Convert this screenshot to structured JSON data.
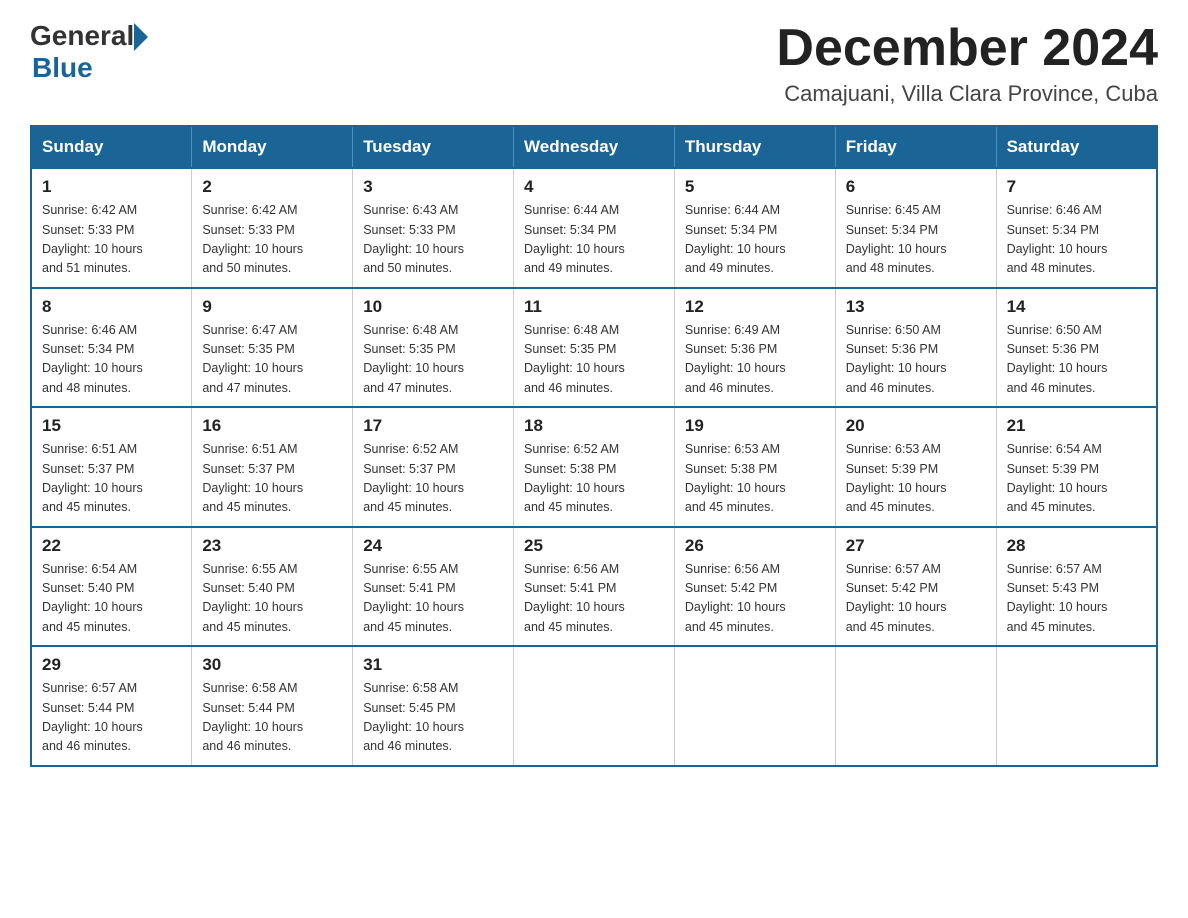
{
  "header": {
    "logo_general": "General",
    "logo_blue": "Blue",
    "month_title": "December 2024",
    "subtitle": "Camajuani, Villa Clara Province, Cuba"
  },
  "days_of_week": [
    "Sunday",
    "Monday",
    "Tuesday",
    "Wednesday",
    "Thursday",
    "Friday",
    "Saturday"
  ],
  "weeks": [
    [
      {
        "day": "1",
        "sunrise": "6:42 AM",
        "sunset": "5:33 PM",
        "daylight": "10 hours and 51 minutes."
      },
      {
        "day": "2",
        "sunrise": "6:42 AM",
        "sunset": "5:33 PM",
        "daylight": "10 hours and 50 minutes."
      },
      {
        "day": "3",
        "sunrise": "6:43 AM",
        "sunset": "5:33 PM",
        "daylight": "10 hours and 50 minutes."
      },
      {
        "day": "4",
        "sunrise": "6:44 AM",
        "sunset": "5:34 PM",
        "daylight": "10 hours and 49 minutes."
      },
      {
        "day": "5",
        "sunrise": "6:44 AM",
        "sunset": "5:34 PM",
        "daylight": "10 hours and 49 minutes."
      },
      {
        "day": "6",
        "sunrise": "6:45 AM",
        "sunset": "5:34 PM",
        "daylight": "10 hours and 48 minutes."
      },
      {
        "day": "7",
        "sunrise": "6:46 AM",
        "sunset": "5:34 PM",
        "daylight": "10 hours and 48 minutes."
      }
    ],
    [
      {
        "day": "8",
        "sunrise": "6:46 AM",
        "sunset": "5:34 PM",
        "daylight": "10 hours and 48 minutes."
      },
      {
        "day": "9",
        "sunrise": "6:47 AM",
        "sunset": "5:35 PM",
        "daylight": "10 hours and 47 minutes."
      },
      {
        "day": "10",
        "sunrise": "6:48 AM",
        "sunset": "5:35 PM",
        "daylight": "10 hours and 47 minutes."
      },
      {
        "day": "11",
        "sunrise": "6:48 AM",
        "sunset": "5:35 PM",
        "daylight": "10 hours and 46 minutes."
      },
      {
        "day": "12",
        "sunrise": "6:49 AM",
        "sunset": "5:36 PM",
        "daylight": "10 hours and 46 minutes."
      },
      {
        "day": "13",
        "sunrise": "6:50 AM",
        "sunset": "5:36 PM",
        "daylight": "10 hours and 46 minutes."
      },
      {
        "day": "14",
        "sunrise": "6:50 AM",
        "sunset": "5:36 PM",
        "daylight": "10 hours and 46 minutes."
      }
    ],
    [
      {
        "day": "15",
        "sunrise": "6:51 AM",
        "sunset": "5:37 PM",
        "daylight": "10 hours and 45 minutes."
      },
      {
        "day": "16",
        "sunrise": "6:51 AM",
        "sunset": "5:37 PM",
        "daylight": "10 hours and 45 minutes."
      },
      {
        "day": "17",
        "sunrise": "6:52 AM",
        "sunset": "5:37 PM",
        "daylight": "10 hours and 45 minutes."
      },
      {
        "day": "18",
        "sunrise": "6:52 AM",
        "sunset": "5:38 PM",
        "daylight": "10 hours and 45 minutes."
      },
      {
        "day": "19",
        "sunrise": "6:53 AM",
        "sunset": "5:38 PM",
        "daylight": "10 hours and 45 minutes."
      },
      {
        "day": "20",
        "sunrise": "6:53 AM",
        "sunset": "5:39 PM",
        "daylight": "10 hours and 45 minutes."
      },
      {
        "day": "21",
        "sunrise": "6:54 AM",
        "sunset": "5:39 PM",
        "daylight": "10 hours and 45 minutes."
      }
    ],
    [
      {
        "day": "22",
        "sunrise": "6:54 AM",
        "sunset": "5:40 PM",
        "daylight": "10 hours and 45 minutes."
      },
      {
        "day": "23",
        "sunrise": "6:55 AM",
        "sunset": "5:40 PM",
        "daylight": "10 hours and 45 minutes."
      },
      {
        "day": "24",
        "sunrise": "6:55 AM",
        "sunset": "5:41 PM",
        "daylight": "10 hours and 45 minutes."
      },
      {
        "day": "25",
        "sunrise": "6:56 AM",
        "sunset": "5:41 PM",
        "daylight": "10 hours and 45 minutes."
      },
      {
        "day": "26",
        "sunrise": "6:56 AM",
        "sunset": "5:42 PM",
        "daylight": "10 hours and 45 minutes."
      },
      {
        "day": "27",
        "sunrise": "6:57 AM",
        "sunset": "5:42 PM",
        "daylight": "10 hours and 45 minutes."
      },
      {
        "day": "28",
        "sunrise": "6:57 AM",
        "sunset": "5:43 PM",
        "daylight": "10 hours and 45 minutes."
      }
    ],
    [
      {
        "day": "29",
        "sunrise": "6:57 AM",
        "sunset": "5:44 PM",
        "daylight": "10 hours and 46 minutes."
      },
      {
        "day": "30",
        "sunrise": "6:58 AM",
        "sunset": "5:44 PM",
        "daylight": "10 hours and 46 minutes."
      },
      {
        "day": "31",
        "sunrise": "6:58 AM",
        "sunset": "5:45 PM",
        "daylight": "10 hours and 46 minutes."
      },
      null,
      null,
      null,
      null
    ]
  ],
  "labels": {
    "sunrise": "Sunrise:",
    "sunset": "Sunset:",
    "daylight": "Daylight:"
  }
}
